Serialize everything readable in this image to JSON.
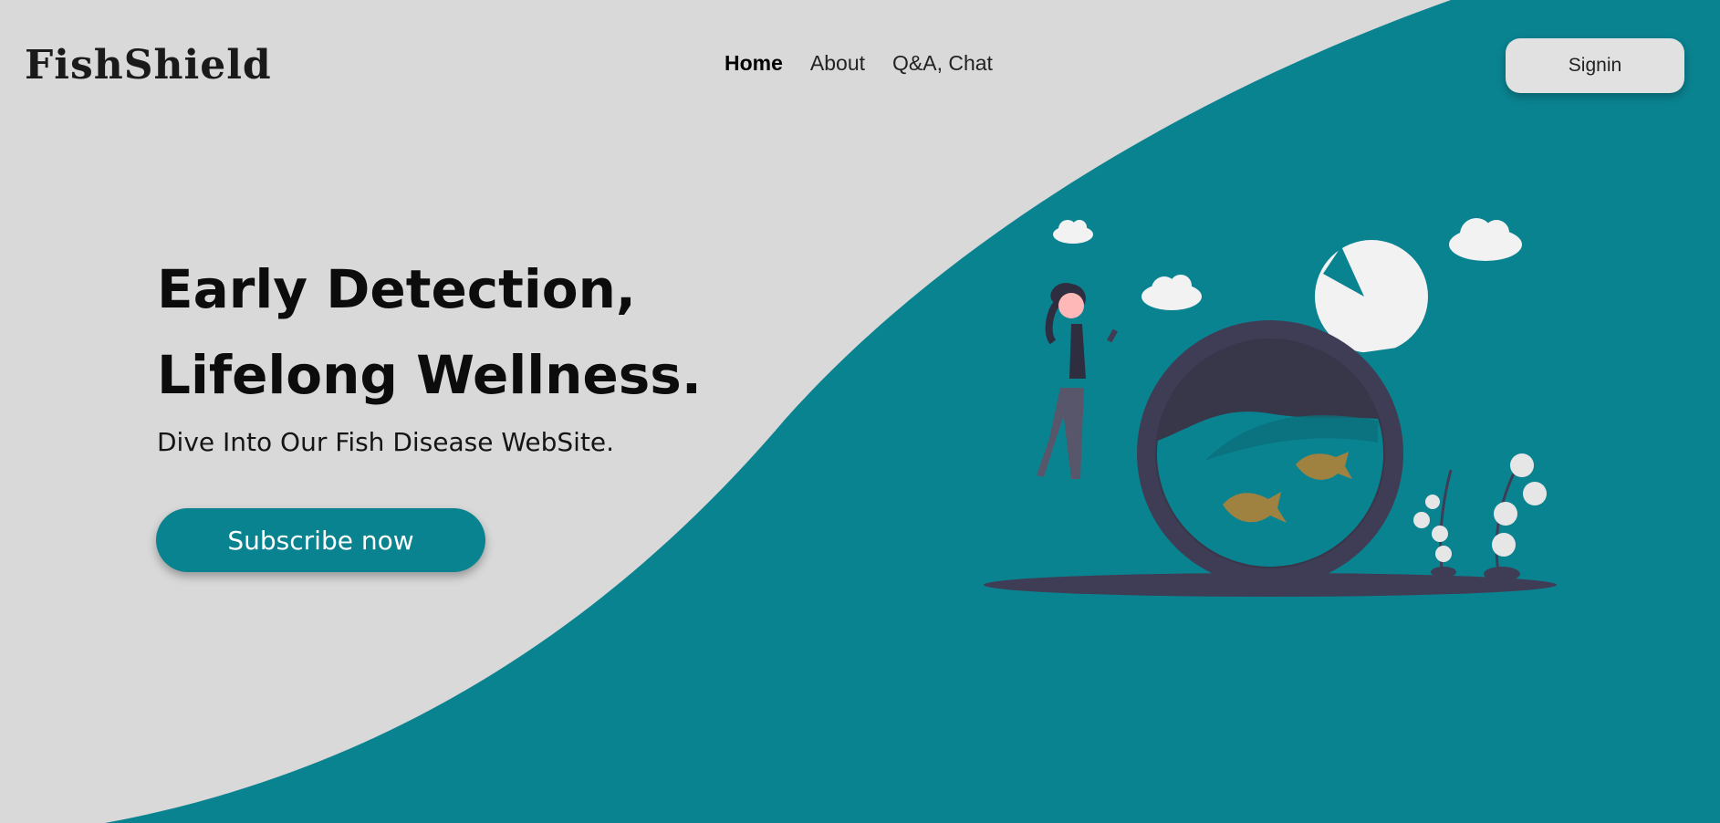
{
  "brand": {
    "logo_text": "FishShield"
  },
  "nav": {
    "items": [
      {
        "label": "Home",
        "active": true
      },
      {
        "label": "About",
        "active": false
      },
      {
        "label": "Q&A, Chat",
        "active": false
      }
    ],
    "signin_label": "Signin"
  },
  "hero": {
    "title": "Early Detection, Lifelong Wellness.",
    "subtitle": "Dive Into Our Fish Disease WebSite.",
    "cta_label": "Subscribe now"
  },
  "colors": {
    "background": "#d9d9d9",
    "accent": "#0a8391",
    "dark": "#3f3d56",
    "fish": "#a08240"
  },
  "icons": {
    "illustration": "woman-with-fishbowl-illustration"
  }
}
